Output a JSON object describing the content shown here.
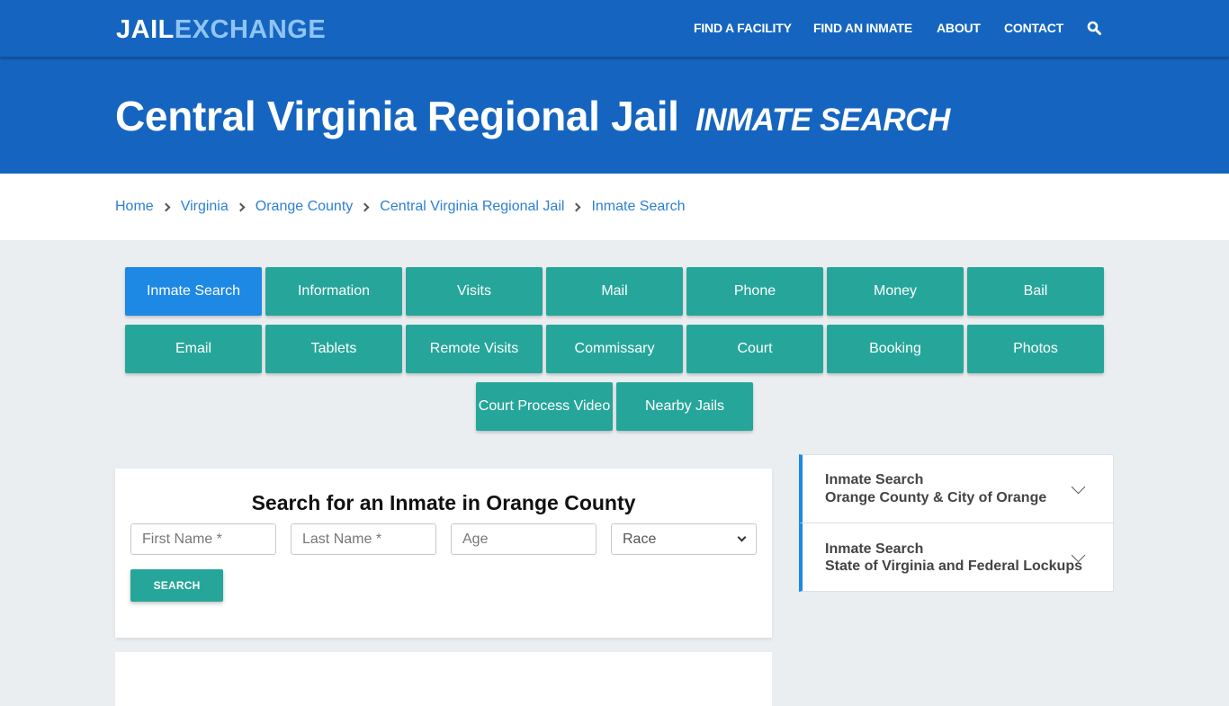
{
  "header": {
    "logo": {
      "part1": "JAIL",
      "part2": "EXCHANGE"
    },
    "nav": [
      {
        "label": "FIND A FACILITY"
      },
      {
        "label": "FIND AN INMATE"
      },
      {
        "label": "ABOUT"
      },
      {
        "label": "CONTACT"
      }
    ],
    "search_icon": "search-icon"
  },
  "hero": {
    "title": "Central Virginia Regional Jail",
    "subtitle": "INMATE SEARCH"
  },
  "breadcrumb": [
    {
      "label": "Home"
    },
    {
      "label": "Virginia"
    },
    {
      "label": "Orange County"
    },
    {
      "label": "Central Virginia Regional Jail"
    },
    {
      "label": "Inmate Search"
    }
  ],
  "tabs": [
    {
      "label": "Inmate Search",
      "active": true
    },
    {
      "label": "Information"
    },
    {
      "label": "Visits"
    },
    {
      "label": "Mail"
    },
    {
      "label": "Phone"
    },
    {
      "label": "Money"
    },
    {
      "label": "Bail"
    },
    {
      "label": "Email"
    },
    {
      "label": "Tablets"
    },
    {
      "label": "Remote Visits"
    },
    {
      "label": "Commissary"
    },
    {
      "label": "Court"
    },
    {
      "label": "Booking"
    },
    {
      "label": "Photos"
    },
    {
      "label": "Court Process Video"
    },
    {
      "label": "Nearby Jails"
    }
  ],
  "search_form": {
    "title": "Search for an Inmate in Orange County",
    "first_name_placeholder": "First Name *",
    "last_name_placeholder": "Last Name *",
    "age_placeholder": "Age",
    "race_selected": "Race",
    "submit_label": "SEARCH"
  },
  "sidebar": {
    "accordions": [
      {
        "line1": "Inmate Search",
        "line2": "Orange County & City of Orange"
      },
      {
        "line1": "Inmate Search",
        "line2": "State of Virginia and Federal Lockups"
      }
    ]
  },
  "colors": {
    "brand_blue": "#1565c0",
    "logo_accent": "#8fc4f5",
    "tab_teal": "#26a69a",
    "tab_active": "#1e88e5",
    "link": "#2c7fd6"
  }
}
